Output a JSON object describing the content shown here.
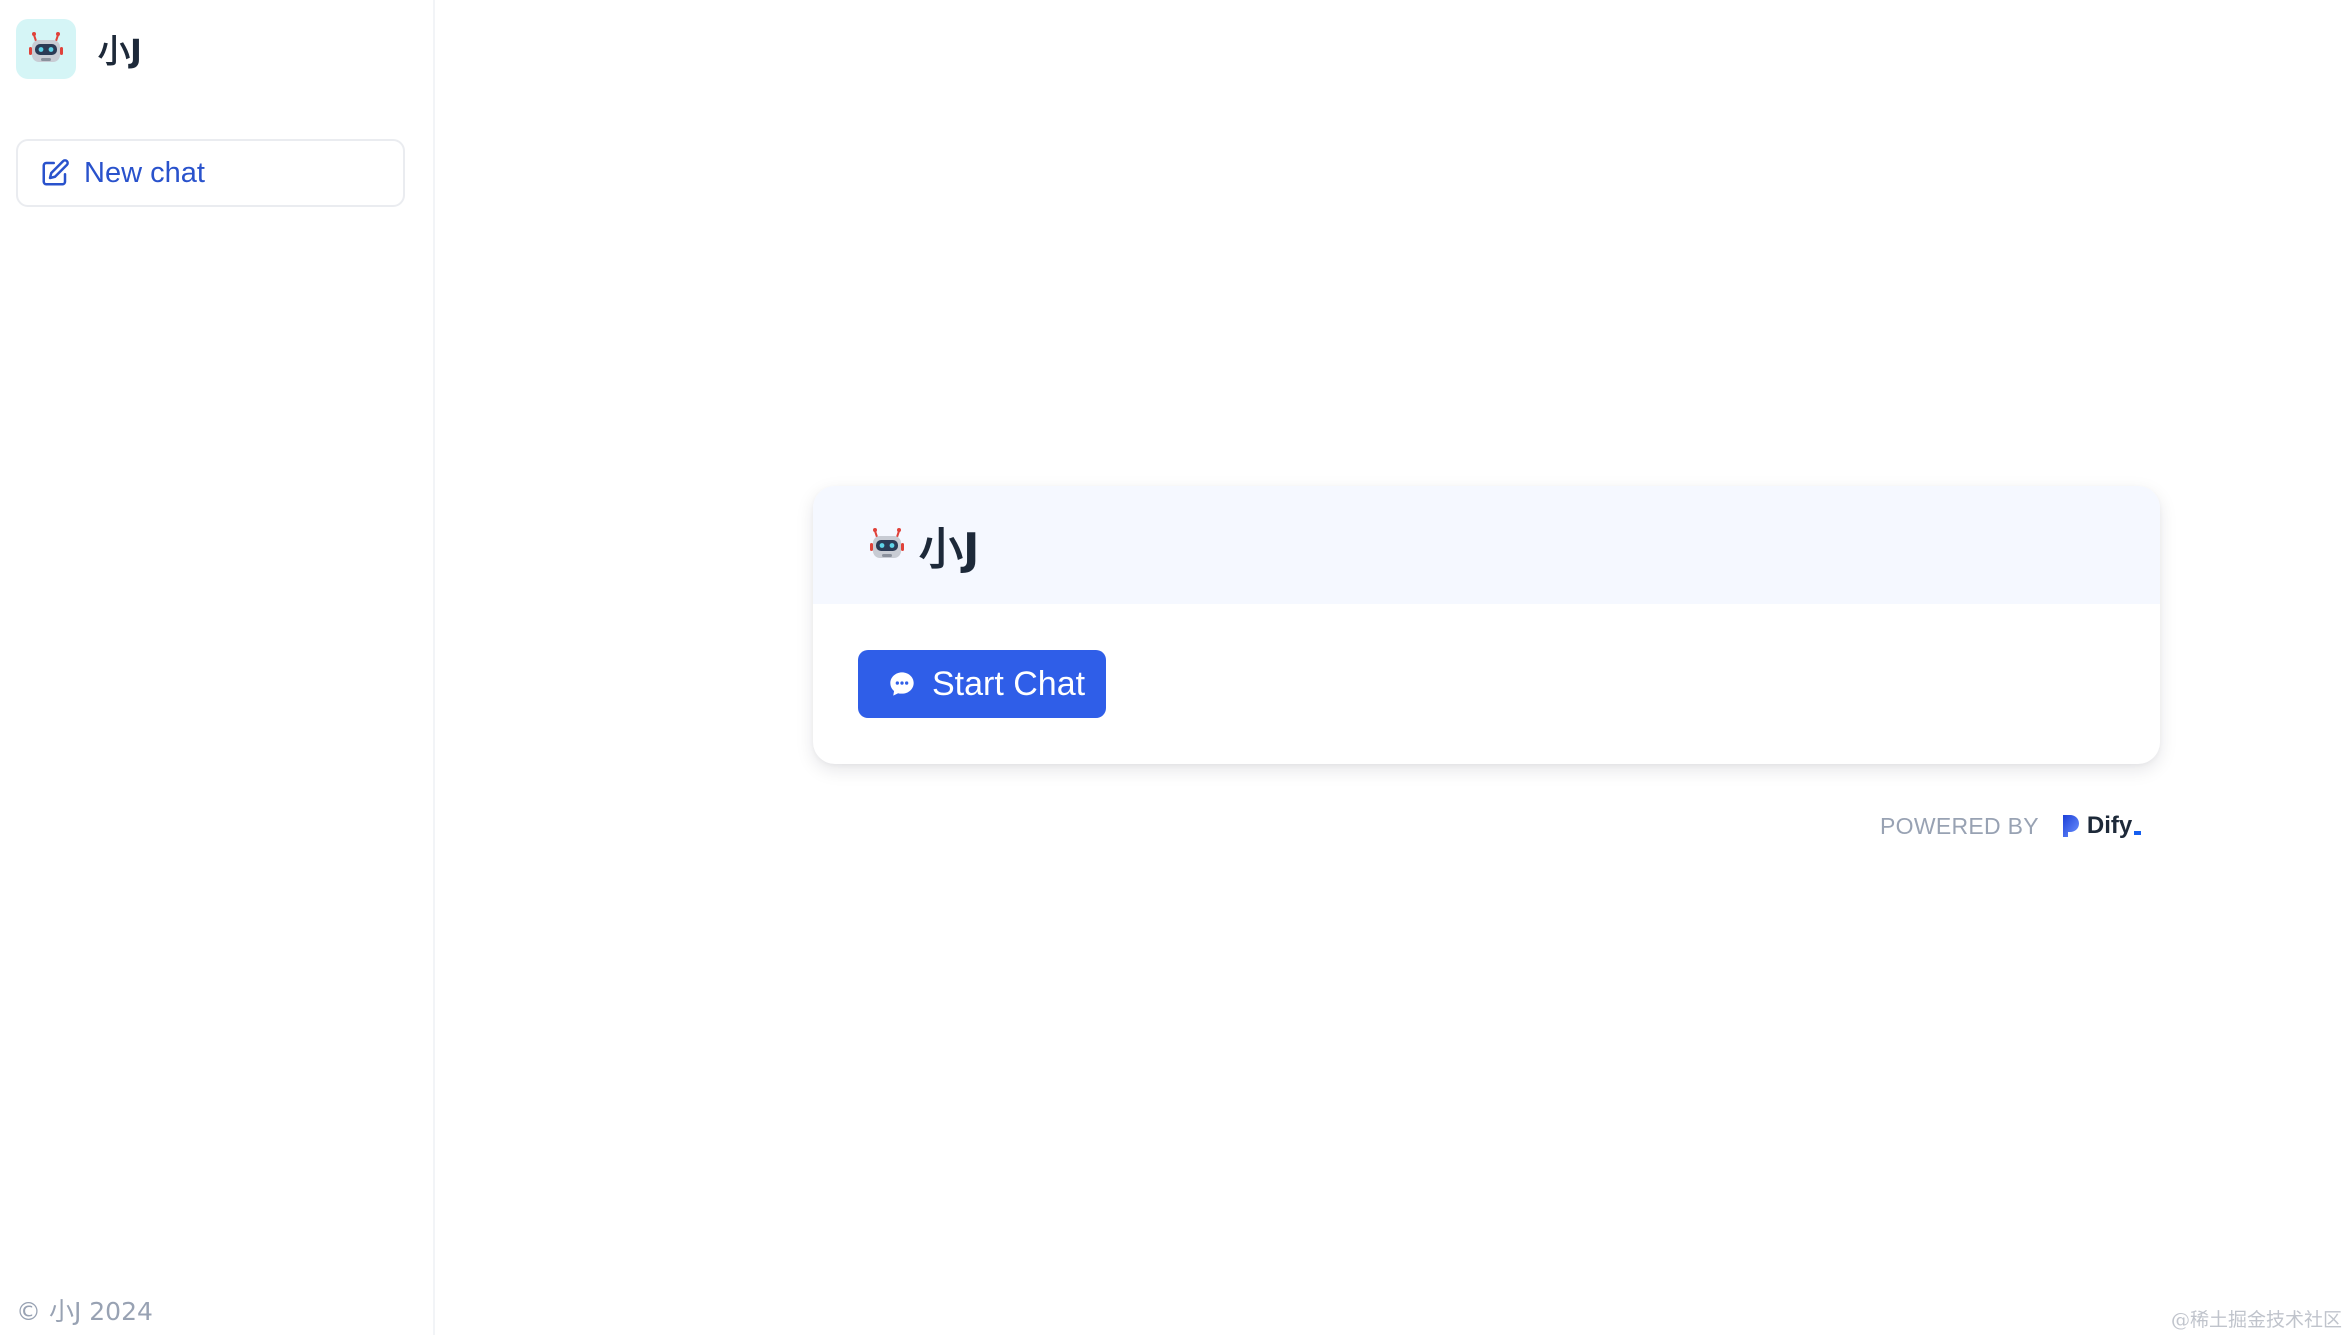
{
  "sidebar": {
    "app_name": "小J",
    "new_chat_label": "New chat",
    "copyright": "© 小J 2024"
  },
  "main": {
    "card_title": "小J",
    "start_chat_label": "Start Chat",
    "powered_by": "POWERED BY",
    "brand": "Dify"
  },
  "watermark": "@稀土掘金技术社区",
  "icons": {
    "app_avatar": "robot-icon",
    "new_chat": "edit-icon",
    "start_chat": "chat-bubble-icon",
    "brand_logo": "dify-logo-icon"
  },
  "colors": {
    "accent": "#2f5ee8",
    "avatar_bg": "#d5f5f6",
    "card_header_bg": "#f5f8ff"
  }
}
